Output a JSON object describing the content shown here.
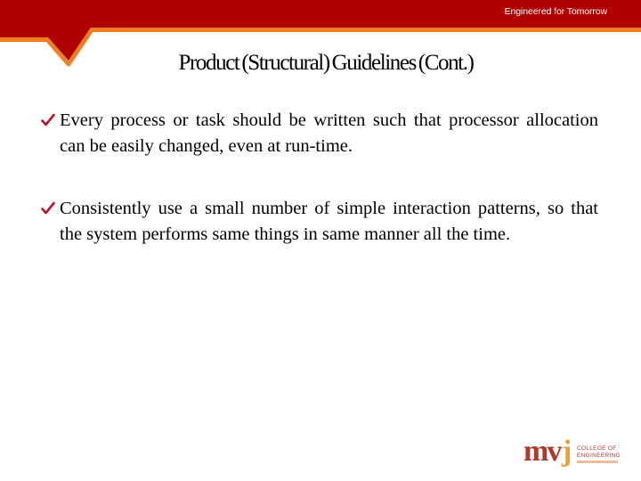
{
  "header": {
    "tagline": "Engineered for Tomorrow",
    "colors": {
      "band": "#b00000",
      "stroke": "#ef7f22"
    }
  },
  "slide": {
    "title": "Product (Structural) Guidelines (Cont.)",
    "bullet_icon": "checkmark-icon",
    "bullet_color": "#c0102a",
    "bullets": [
      {
        "text": "Every process or task should be written such that processor allocation can be easily changed, even at run-time."
      },
      {
        "text": "Consistently use a small number of simple interaction patterns, so that the system performs same things in same manner all the time."
      }
    ]
  },
  "logo": {
    "mark_primary": "mv",
    "mark_accent": "j",
    "line1": "COLLEGE OF",
    "line2": "ENGINEERING",
    "colors": {
      "primary": "#b5372a",
      "accent": "#f0a030"
    }
  }
}
